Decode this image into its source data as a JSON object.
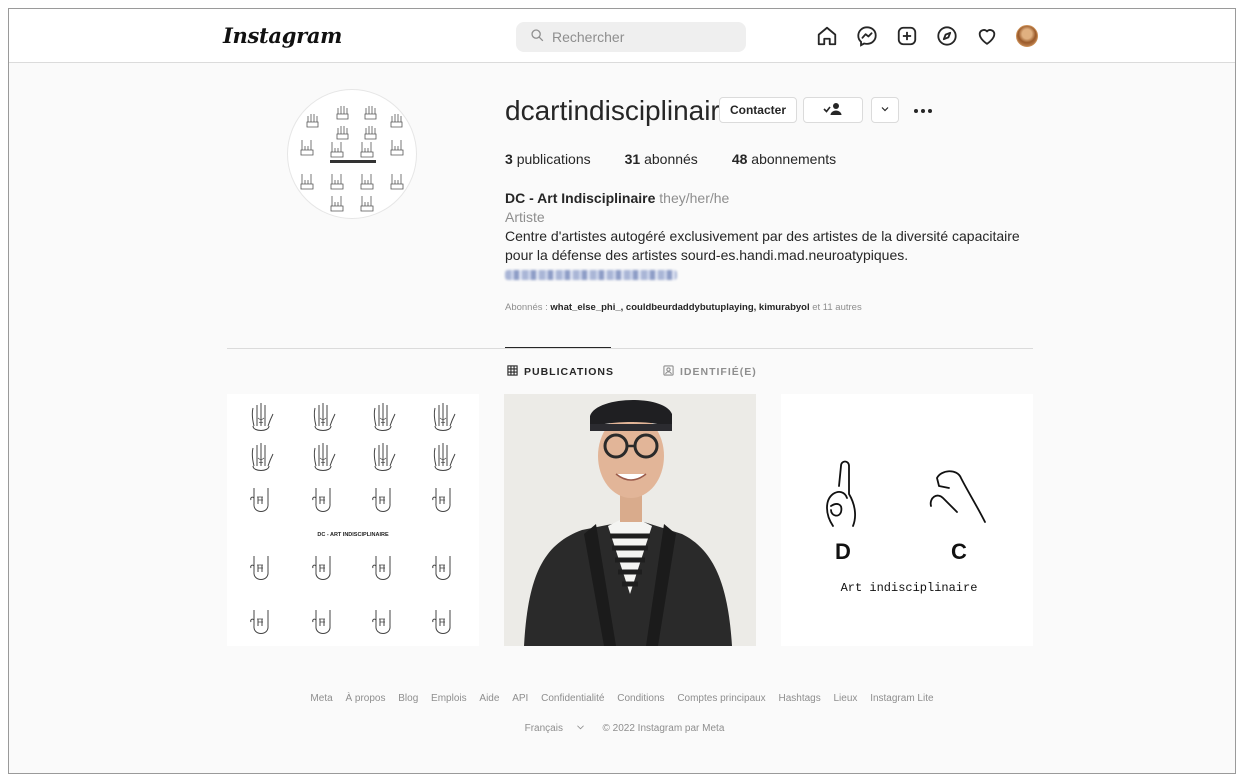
{
  "nav": {
    "logo": "Instagram",
    "search_placeholder": "Rechercher"
  },
  "profile": {
    "username": "dcartindisciplinaire",
    "contact_label": "Contacter",
    "stats": [
      {
        "value": "3",
        "label": "publications"
      },
      {
        "value": "31",
        "label": "abonnés"
      },
      {
        "value": "48",
        "label": "abonnements"
      }
    ],
    "display_name": "DC - Art Indisciplinaire",
    "pronouns": "they/her/he",
    "category": "Artiste",
    "bio_line1": "Centre d'artistes autogéré exclusivement par des artistes de la diversité capacitaire",
    "bio_line2": "pour la défense des artistes sourd-es.handi.mad.neuroatypiques.",
    "followed_by_prefix": "Abonnés : ",
    "followed_by_names": "what_else_phi_, couldbeurdaddybutuplaying, kimurabyol",
    "followed_by_suffix": " et 11 autres"
  },
  "tabs": {
    "publications": "PUBLICATIONS",
    "tagged": "IDENTIFIÉ(E)"
  },
  "posts": {
    "post1_caption": "DC - ART INDISCIPLINAIRE",
    "post3_letter_d": "D",
    "post3_letter_c": "C",
    "post3_caption": "Art indisciplinaire"
  },
  "footer": {
    "links": [
      "Meta",
      "À propos",
      "Blog",
      "Emplois",
      "Aide",
      "API",
      "Confidentialité",
      "Conditions",
      "Comptes principaux",
      "Hashtags",
      "Lieux",
      "Instagram Lite"
    ],
    "language": "Français",
    "copyright": "© 2022 Instagram par Meta"
  }
}
